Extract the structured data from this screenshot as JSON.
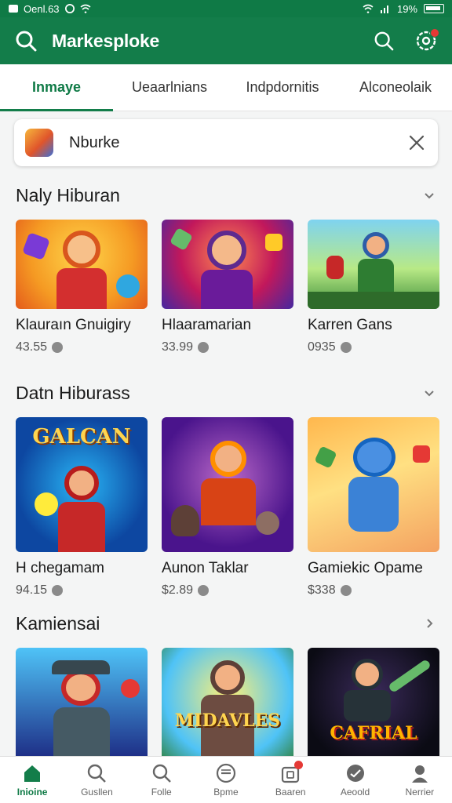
{
  "status_bar": {
    "left_text": "Oenl.63",
    "right_text": "19%"
  },
  "app_bar": {
    "title": "Markesploke"
  },
  "tabs": [
    {
      "label": "Inmaye",
      "active": true
    },
    {
      "label": "Ueaarlnians",
      "active": false
    },
    {
      "label": "Indpdornitis",
      "active": false
    },
    {
      "label": "Alconeolaik",
      "active": false
    }
  ],
  "filter_chip": {
    "text": "Nburke"
  },
  "sections": [
    {
      "title": "Naly Hiburan",
      "cards": [
        {
          "name": "Klauraın Gnuigiry",
          "price": "43.55"
        },
        {
          "name": "Hlaaramarian",
          "price": "33.99"
        },
        {
          "name": "Karren Gans",
          "price": "0935"
        }
      ]
    },
    {
      "title": "Datn Hiburass",
      "cards": [
        {
          "name": "H chegamam",
          "price": "94.15",
          "art_text": "GALCAN"
        },
        {
          "name": "Aunon Taklar",
          "price": "$2.89"
        },
        {
          "name": "Gamiekic Opame",
          "price": "$338"
        }
      ]
    },
    {
      "title": "Kamiensai",
      "cards": [
        {
          "name": "",
          "price": ""
        },
        {
          "name": "",
          "price": "",
          "art_text": "MIDAVLES"
        },
        {
          "name": "",
          "price": "",
          "art_text": "CAFRIAL"
        }
      ]
    }
  ],
  "bottom_nav": [
    {
      "label": "Inioine",
      "icon": "home-icon",
      "active": true
    },
    {
      "label": "Gusllen",
      "icon": "search-icon",
      "active": false
    },
    {
      "label": "Folle",
      "icon": "search-icon",
      "active": false
    },
    {
      "label": "Bpme",
      "icon": "compass-icon",
      "active": false
    },
    {
      "label": "Baaren",
      "icon": "bag-icon",
      "active": false
    },
    {
      "label": "Aeoold",
      "icon": "heart-icon",
      "active": false
    },
    {
      "label": "Nerrier",
      "icon": "profile-icon",
      "active": false
    }
  ],
  "colors": {
    "brand_green": "#137d4a",
    "badge_red": "#e53935"
  }
}
